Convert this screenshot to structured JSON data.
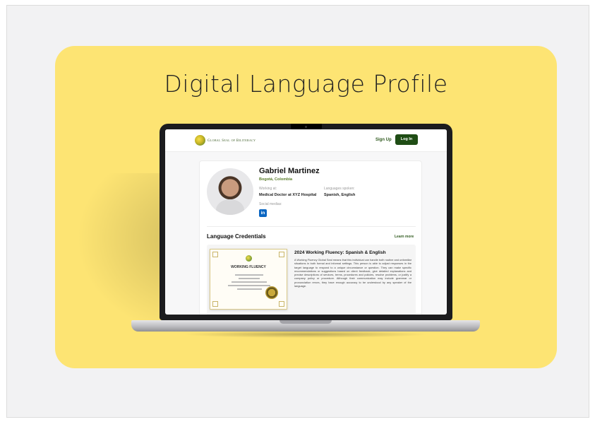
{
  "hero": {
    "title": "Digital Language Profile"
  },
  "site": {
    "logo_text": "Global Seal of Biliteracy",
    "nav": {
      "signup": "Sign Up",
      "login": "Log In"
    }
  },
  "profile": {
    "name": "Gabriel Martinez",
    "location": "Bogotá, Colombia",
    "working_at_label": "Working at:",
    "working_at_value": "Medical Doctor at XYZ Hospital",
    "languages_label": "Languages spoken:",
    "languages_value": "Spanish, English",
    "social_label": "Social medias:",
    "social_icon": "in"
  },
  "credentials": {
    "title": "Language Credentials",
    "learn_more": "Learn more",
    "items": [
      {
        "title": "2024 Working Fluency: Spanish & English",
        "certificate_heading": "WORKING FLUENCY",
        "description": "A Working Fluency Global Seal means that this individual can handle both routine and unfamiliar situations in both formal and informal settings. This person is able to adjust responses in the target language to respond to a unique circumstance or question. They can make specific recommendations or suggestions based on client feedback, give detailed explanations and precise descriptions of services, terms, procedures and policies, resolve problems, or justify a company policy or procedure. Although their communication may include grammar or pronunciation errors, they have enough accuracy to be understood by any speaker of the language."
      }
    ]
  }
}
